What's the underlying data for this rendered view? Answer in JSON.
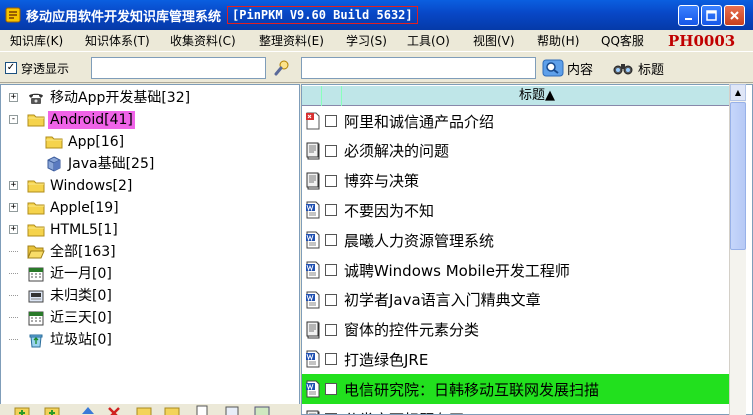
{
  "window": {
    "title": "移动应用软件开发知识库管理系统",
    "version": "[PinPKM V9.60 Build 5632]"
  },
  "menu": [
    "知识库(K)",
    "知识体系(T)",
    "收集资料(C)",
    "整理资料(E)",
    "学习(S)",
    "工具(O)",
    "视图(V)",
    "帮助(H)",
    "QQ客服"
  ],
  "menu_code": "PH0003",
  "toolbar": {
    "transparent_label": "穿透显示",
    "transparent_checked": true,
    "left_input_value": "",
    "search_value": "",
    "content_label": "内容",
    "title_label": "标题"
  },
  "tree": [
    {
      "label": "移动App开发基础[32]",
      "icon": "phone-icon",
      "expander": "+",
      "level": 0
    },
    {
      "label": "Android[41]",
      "icon": "folder-icon",
      "expander": "-",
      "level": 0,
      "selected": true
    },
    {
      "label": "App[16]",
      "icon": "folder-icon",
      "expander": "",
      "level": 1
    },
    {
      "label": "Java基础[25]",
      "icon": "cube-icon",
      "expander": "",
      "level": 1
    },
    {
      "label": "Windows[2]",
      "icon": "folder-icon",
      "expander": "+",
      "level": 0
    },
    {
      "label": "Apple[19]",
      "icon": "folder-icon",
      "expander": "+",
      "level": 0
    },
    {
      "label": "HTML5[1]",
      "icon": "folder-icon",
      "expander": "+",
      "level": 0
    },
    {
      "label": "全部[163]",
      "icon": "open-folder-icon",
      "expander": "",
      "level": 0
    },
    {
      "label": "近一月[0]",
      "icon": "calendar-icon",
      "expander": "",
      "level": 0
    },
    {
      "label": "未归类[0]",
      "icon": "unsorted-icon",
      "expander": "",
      "level": 0
    },
    {
      "label": "近三天[0]",
      "icon": "calendar-icon",
      "expander": "",
      "level": 0
    },
    {
      "label": "垃圾站[0]",
      "icon": "recycle-icon",
      "expander": "",
      "level": 0
    }
  ],
  "list": {
    "header_title": "标题▲",
    "rows": [
      {
        "title": "阿里和诚信通产品介绍",
        "icon": "pdf-doc-icon"
      },
      {
        "title": "必须解决的问题",
        "icon": "note-doc-icon"
      },
      {
        "title": "博弈与决策",
        "icon": "note-doc-icon"
      },
      {
        "title": "不要因为不知",
        "icon": "word-doc-icon"
      },
      {
        "title": "晨曦人力资源管理系统",
        "icon": "word-doc-icon"
      },
      {
        "title": "诚聘Windows Mobile开发工程师",
        "icon": "word-doc-icon"
      },
      {
        "title": "初学者Java语言入门精典文章",
        "icon": "word-doc-icon"
      },
      {
        "title": "窗体的控件元素分类",
        "icon": "note-doc-icon"
      },
      {
        "title": "打造绿色JRE",
        "icon": "word-doc-icon"
      },
      {
        "title": "电信研究院：日韩移动互联网发展扫描",
        "icon": "word-doc-icon",
        "highlight": true
      },
      {
        "title": "分类方面标题有正",
        "icon": "note-doc-icon"
      }
    ]
  },
  "colors": {
    "title_bar": "#0847c6",
    "selected_tree": "#f063e8",
    "highlight_row": "#22e01e",
    "code_text": "#c00000",
    "list_header": "#bfe6e8"
  }
}
